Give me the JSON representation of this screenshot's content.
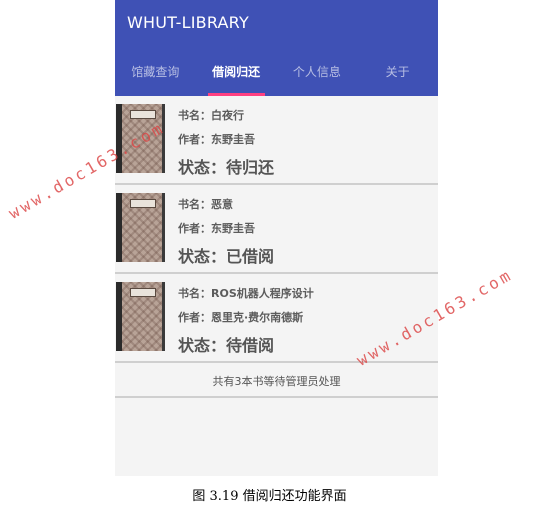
{
  "app": {
    "title": "WHUT-LIBRARY",
    "accent_color": "#3f51b5",
    "indicator_color": "#ff4081"
  },
  "tabs": [
    {
      "label": "馆藏查询",
      "active": false
    },
    {
      "label": "借阅归还",
      "active": true
    },
    {
      "label": "个人信息",
      "active": false
    },
    {
      "label": "关于",
      "active": false
    }
  ],
  "books": [
    {
      "title": "书名：白夜行",
      "author": "作者：东野圭吾",
      "status": "状态：待归还"
    },
    {
      "title": "书名：恶意",
      "author": "作者：东野圭吾",
      "status": "状态：已借阅"
    },
    {
      "title": "书名：ROS机器人程序设计",
      "author": "作者：恩里克·费尔南德斯",
      "status": "状态：待借阅"
    }
  ],
  "summary": "共有3本书等待管理员处理",
  "caption": "图 3.19 借阅归还功能界面",
  "watermark": "www.doc163.com"
}
